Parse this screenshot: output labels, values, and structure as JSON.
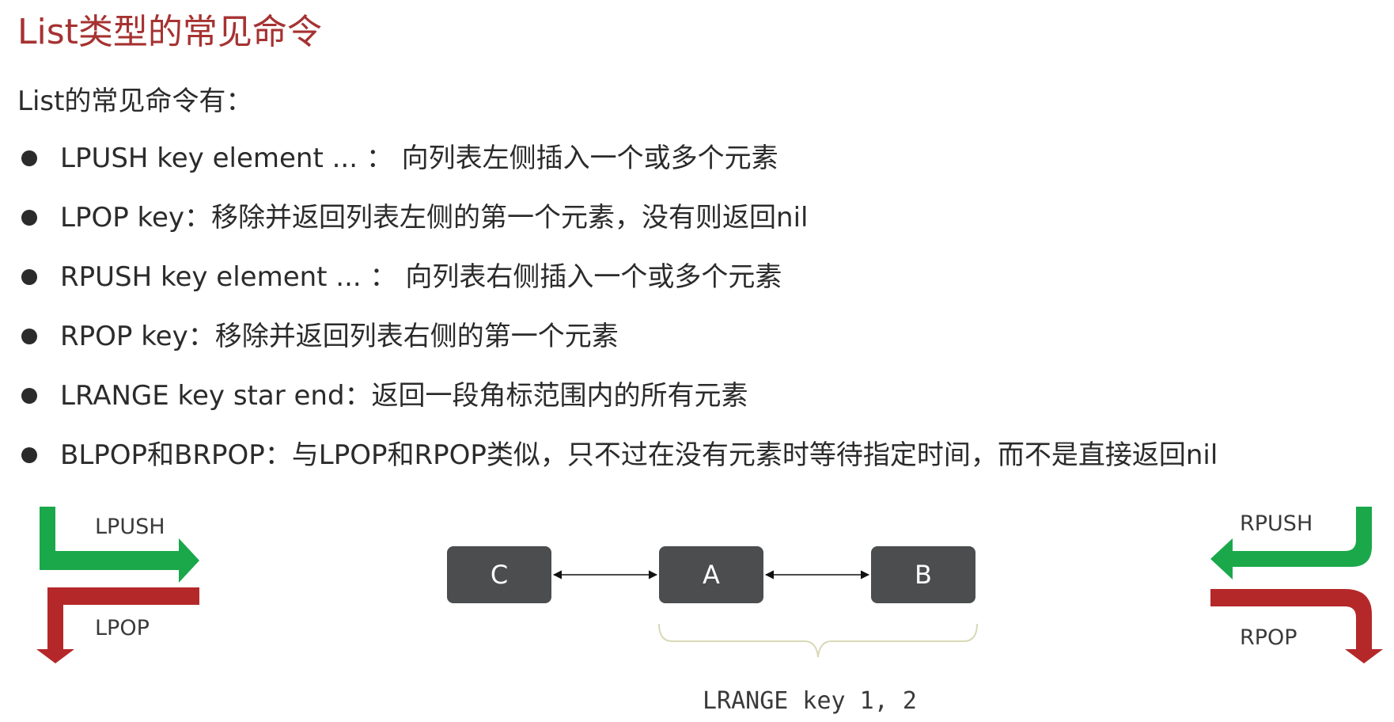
{
  "title": "List类型的常见命令",
  "intro": "List的常见命令有：",
  "commands": [
    {
      "text": "LPUSH key  element ... ： 向列表左侧插入一个或多个元素"
    },
    {
      "text": "LPOP key：移除并返回列表左侧的第一个元素，没有则返回nil"
    },
    {
      "text": "RPUSH key  element ... ： 向列表右侧插入一个或多个元素"
    },
    {
      "text": "RPOP key：移除并返回列表右侧的第一个元素"
    },
    {
      "text": "LRANGE key star end：返回一段角标范围内的所有元素"
    },
    {
      "text": "BLPOP和BRPOP：与LPOP和RPOP类似，只不过在没有元素时等待指定时间，而不是直接返回nil"
    }
  ],
  "diagram": {
    "nodes": [
      "C",
      "A",
      "B"
    ],
    "lpush_label": "LPUSH",
    "lpop_label": "LPOP",
    "rpush_label": "RPUSH",
    "rpop_label": "RPOP",
    "range_caption": "LRANGE key 1, 2",
    "colors": {
      "push": "#1aa84a",
      "pop": "#b5282a",
      "node": "#4b4d4e",
      "title": "#a63232",
      "brace": "#d9d9b8"
    }
  }
}
